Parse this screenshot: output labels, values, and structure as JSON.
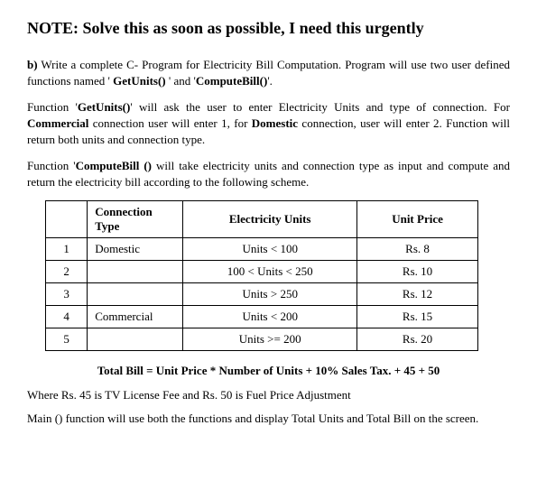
{
  "note": "NOTE: Solve this as soon as possible, I need this urgently",
  "question_label": "b)",
  "intro_text": " Write a complete C- Program for Electricity Bill Computation. Program will use two user defined functions named ' ",
  "fn1": "GetUnits()",
  "intro_mid": " ' and '",
  "fn2": "ComputeBill()",
  "intro_end": "'.",
  "p1_a": "Function '",
  "p1_fn": "GetUnits()",
  "p1_b": "' will ask the user to enter Electricity Units and type of connection. For ",
  "p1_comm": "Commercial",
  "p1_c": " connection user will enter 1, for ",
  "p1_dom": "Domestic",
  "p1_d": " connection, user will enter 2. Function will return both units and connection type.",
  "p2_a": "Function '",
  "p2_fn": "ComputeBill ()",
  "p2_b": " will take electricity units and connection type as input and compute and return the electricity bill according to the following scheme.",
  "table": {
    "headers": {
      "conn": "Connection Type",
      "units": "Electricity Units",
      "price": "Unit Price"
    },
    "rows": [
      {
        "n": "1",
        "conn": "Domestic",
        "units": "Units < 100",
        "price": "Rs. 8"
      },
      {
        "n": "2",
        "conn": "",
        "units": "100 < Units < 250",
        "price": "Rs. 10"
      },
      {
        "n": "3",
        "conn": "",
        "units": "Units > 250",
        "price": "Rs. 12"
      },
      {
        "n": "4",
        "conn": "Commercial",
        "units": "Units < 200",
        "price": "Rs. 15"
      },
      {
        "n": "5",
        "conn": "",
        "units": "Units >= 200",
        "price": "Rs. 20"
      }
    ]
  },
  "formula": "Total Bill = Unit Price * Number of Units + 10% Sales Tax. + 45  + 50",
  "foot1": "Where Rs. 45 is TV License Fee  and Rs. 50 is Fuel Price Adjustment",
  "foot2": "Main () function will use both the functions and display Total Units and Total Bill on the screen."
}
